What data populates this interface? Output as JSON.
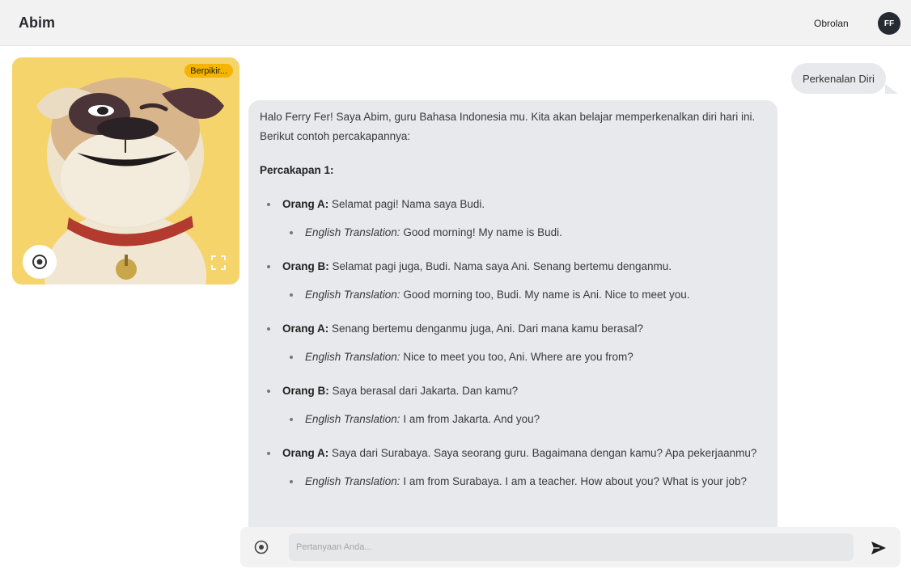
{
  "header": {
    "title": "Abim",
    "nav_link": "Obrolan",
    "avatar_initials": "FF"
  },
  "character": {
    "status_badge": "Berpikir...",
    "icons": {
      "record": "record-icon",
      "fullscreen": "fullscreen-icon"
    }
  },
  "chat": {
    "user_message": "Perkenalan Diri",
    "bot_message": {
      "intro": "Halo Ferry Fer! Saya Abim, guru Bahasa Indonesia mu. Kita akan belajar memperkenalkan diri hari ini. Berikut contoh percakapannya:",
      "heading": "Percakapan 1:",
      "translation_label": "English Translation:",
      "turns": [
        {
          "speaker": "Orang A:",
          "text": "Selamat pagi! Nama saya Budi.",
          "translation": "Good morning! My name is Budi."
        },
        {
          "speaker": "Orang B:",
          "text": "Selamat pagi juga, Budi. Nama saya Ani. Senang bertemu denganmu.",
          "translation": "Good morning too, Budi. My name is Ani. Nice to meet you."
        },
        {
          "speaker": "Orang A:",
          "text": "Senang bertemu denganmu juga, Ani. Dari mana kamu berasal?",
          "translation": "Nice to meet you too, Ani. Where are you from?"
        },
        {
          "speaker": "Orang B:",
          "text": "Saya berasal dari Jakarta. Dan kamu?",
          "translation": "I am from Jakarta. And you?"
        },
        {
          "speaker": "Orang A:",
          "text": "Saya dari Surabaya. Saya seorang guru. Bagaimana dengan kamu? Apa pekerjaanmu?",
          "translation": "I am from Surabaya. I am a teacher. How about you? What is your job?"
        }
      ]
    }
  },
  "composer": {
    "placeholder": "Pertanyaan Anda...",
    "value": "",
    "icons": {
      "record": "record-icon",
      "send": "send-icon"
    }
  },
  "colors": {
    "card_background": "#f6d46c",
    "badge": "#f4b400",
    "bubble": "#e8e9ec",
    "avatar": "#262a33"
  }
}
